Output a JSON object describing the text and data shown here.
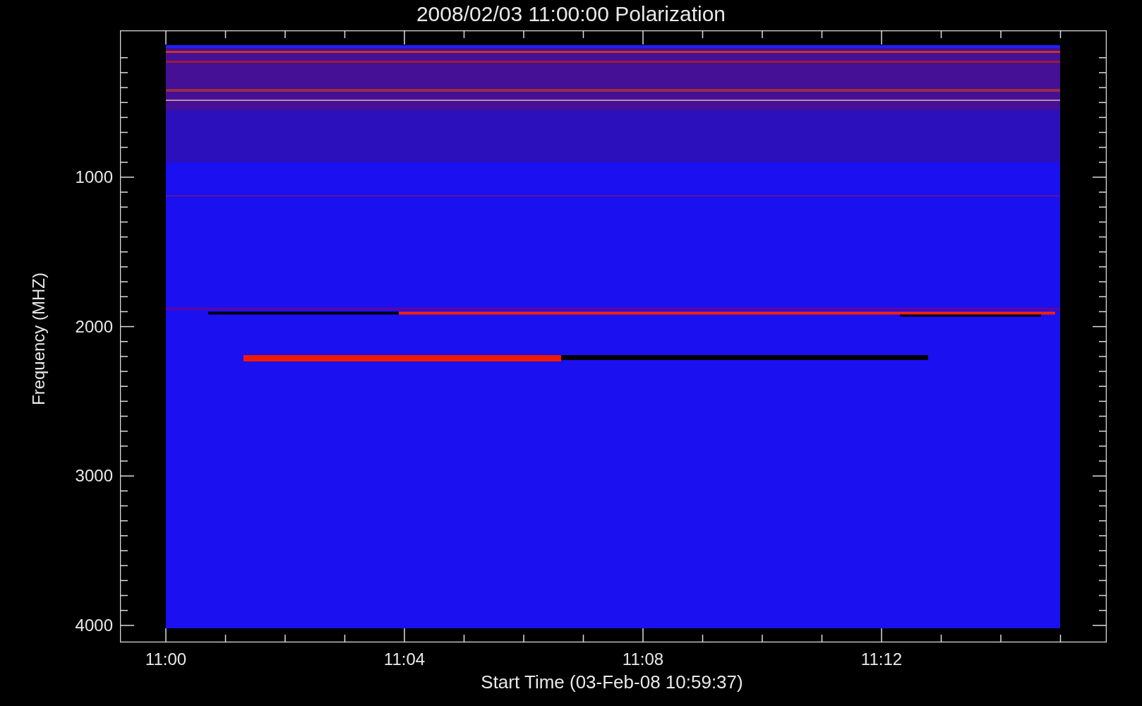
{
  "title": "2008/02/03 11:00:00 Polarization",
  "y_axis": {
    "label": "Frequency (MHZ)",
    "ticks": [
      "1000",
      "2000",
      "3000",
      "4000"
    ]
  },
  "x_axis": {
    "label": "Start Time (03-Feb-08 10:59:37)",
    "ticks": [
      "11:00",
      "11:04",
      "11:08",
      "11:12"
    ]
  }
}
